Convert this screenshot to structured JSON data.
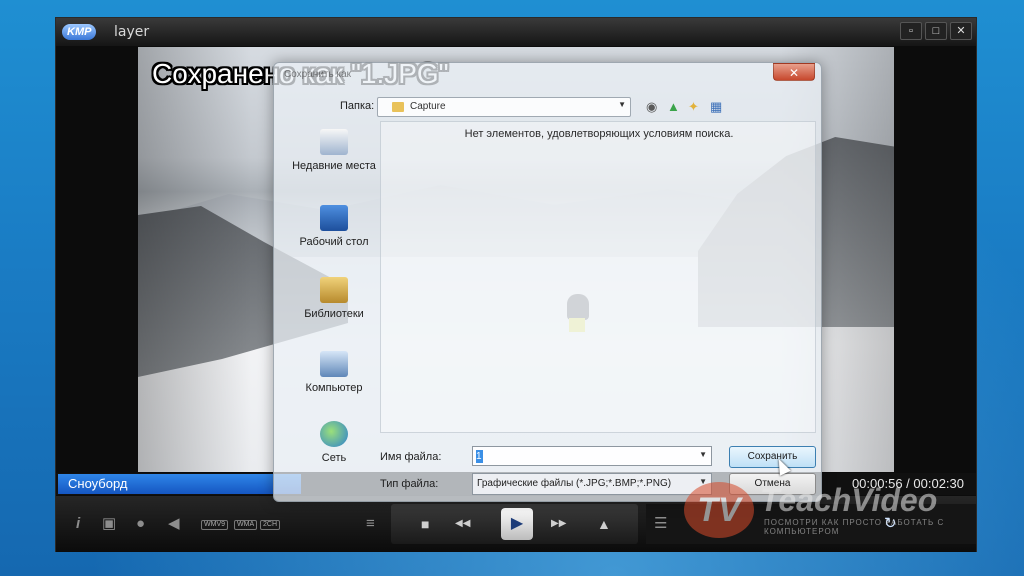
{
  "window": {
    "logo": "KMP",
    "title": "layer",
    "btn_minimize": "▫",
    "btn_maximize": "□",
    "btn_close": "✕"
  },
  "video": {
    "osd_message": "Сохранено как \"1.JPG\""
  },
  "statusbar": {
    "playlist_title": "Сноуборд",
    "time": "00:00:56 / 00:02:30"
  },
  "controls": {
    "codec_1": "WMV9",
    "codec_2": "WMA",
    "codec_3": "2CH",
    "info_icon": "i",
    "camera_icon": "▣",
    "chat_icon": "●",
    "speaker_icon": "◀",
    "eq_icon": "≡",
    "stop_icon": "■",
    "prev_icon": "◀◀",
    "play_icon": "▶",
    "next_icon": "▶▶",
    "eject_icon": "▲",
    "playlist_icon": "☰",
    "repeat_icon": "↻"
  },
  "dialog": {
    "title": "Сохранить как",
    "close": "✕",
    "folder_label": "Папка:",
    "folder_value": "Capture",
    "empty_message": "Нет элементов, удовлетворяющих условиям поиска.",
    "places": [
      {
        "label": "Недавние места"
      },
      {
        "label": "Рабочий стол"
      },
      {
        "label": "Библиотеки"
      },
      {
        "label": "Компьютер"
      },
      {
        "label": "Сеть"
      }
    ],
    "filename_label": "Имя файла:",
    "filename_value": "1",
    "filetype_label": "Тип файла:",
    "filetype_value": "Графические файлы (*.JPG;*.BMP;*.PNG)",
    "save_label": "Сохранить",
    "cancel_label": "Отмена"
  },
  "watermark": {
    "logo": "TV",
    "title": "TeachVideo",
    "subtitle": "ПОСМОТРИ КАК ПРОСТО РАБОТАТЬ С КОМПЬЮТЕРОМ"
  }
}
